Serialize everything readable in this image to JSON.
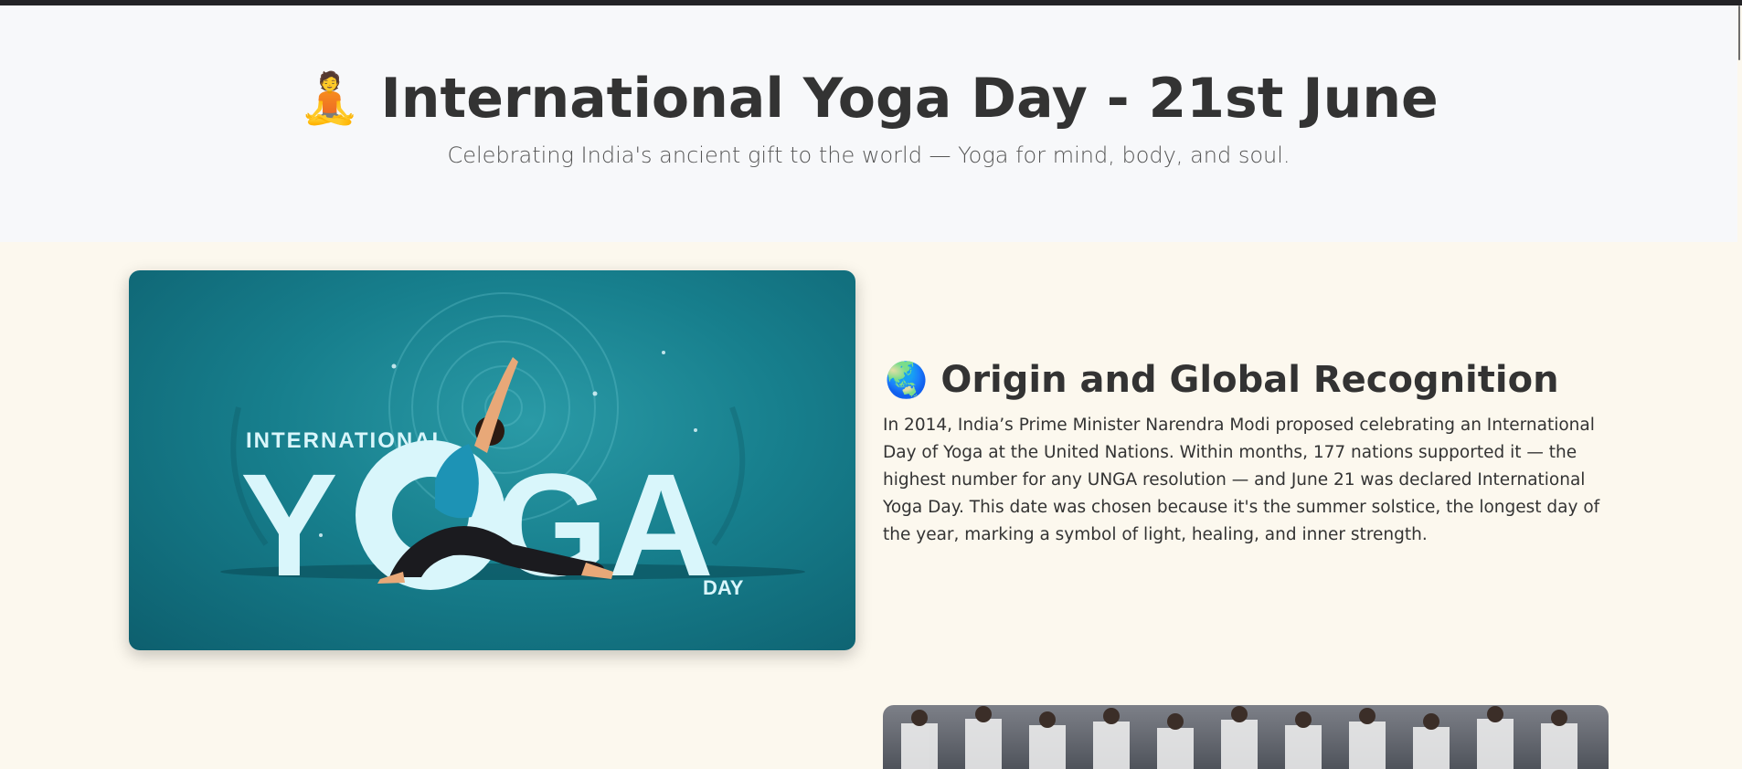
{
  "hero": {
    "emoji": "🧘",
    "title": "International Yoga Day - 21st June",
    "subtitle": "Celebrating India's ancient gift to the world — Yoga for mind, body, and soul."
  },
  "poster": {
    "line1": "INTERNATIONAL",
    "line2_left": "Y",
    "line2_right": "GA",
    "line3": "DAY"
  },
  "section1": {
    "emoji": "🌏",
    "title": "Origin and Global Recognition",
    "body": "In 2014, India’s Prime Minister Narendra Modi proposed celebrating an International Day of Yoga at the United Nations. Within months, 177 nations supported it — the highest number for any UNGA resolution — and June 21 was declared International Yoga Day. This date was chosen because it's the summer solstice, the longest day of the year, marking a symbol of light, healing, and inner strength."
  },
  "colors": {
    "hero_bg": "#f7f8fa",
    "page_bg": "#fcf8ee",
    "heading": "#333333",
    "poster_teal": "#177f8d",
    "poster_letters": "#d9f6fb"
  }
}
